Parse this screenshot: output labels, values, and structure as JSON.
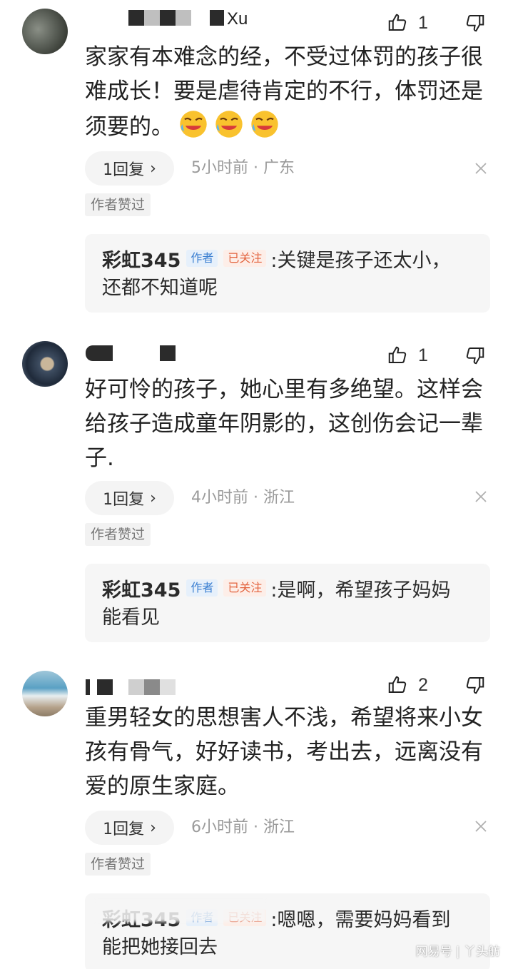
{
  "comments": [
    {
      "name_suffix": "Xu",
      "likes": "1",
      "text": "家家有本难念的经，不受过体罚的孩子很难成长！要是虐待肯定的不行，体罚还是须要的。",
      "reply_pill": "1回复",
      "meta": "5小时前 · 广东",
      "author_liked": "作者赞过",
      "reply": {
        "author": "彩虹345",
        "tag_author": "作者",
        "tag_follow": "已关注",
        "text_line1": ":关键是孩子还太小，",
        "text_line2": "还都不知道呢"
      }
    },
    {
      "name_suffix": "",
      "likes": "1",
      "text": "好可怜的孩子，她心里有多绝望。这样会给孩子造成童年阴影的，这创伤会记一辈子.",
      "reply_pill": "1回复",
      "meta": "4小时前 · 浙江",
      "author_liked": "作者赞过",
      "reply": {
        "author": "彩虹345",
        "tag_author": "作者",
        "tag_follow": "已关注",
        "text_line1": ":是啊，希望孩子妈妈",
        "text_line2": "能看见"
      }
    },
    {
      "name_suffix": "",
      "likes": "2",
      "text": "重男轻女的思想害人不浅，希望将来小女孩有骨气，好好读书，考出去，远离没有爱的原生家庭。",
      "reply_pill": "1回复",
      "meta": "6小时前 · 浙江",
      "author_liked": "作者赞过",
      "reply": {
        "author": "彩虹345",
        "tag_author": "作者",
        "tag_follow": "已关注",
        "text_line1": ":嗯嗯，需要妈妈看到",
        "text_line2": "能把她接回去"
      }
    }
  ],
  "watermark": "网易号 | 丫头舫",
  "colors": {
    "author_tag": "#3b7fd1",
    "follow_tag": "#e3643f",
    "meta_gray": "#9a9a9a"
  }
}
